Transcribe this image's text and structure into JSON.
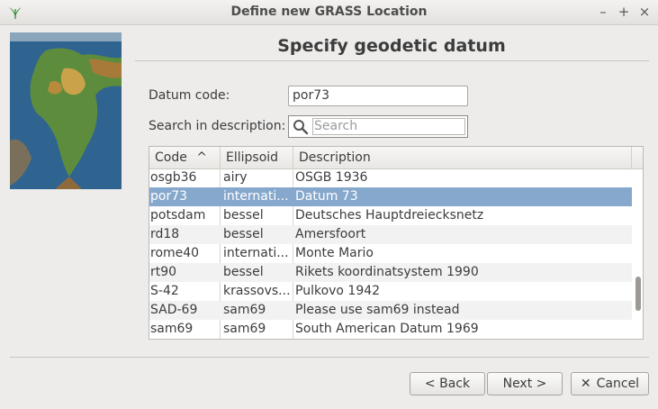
{
  "window": {
    "title": "Define new GRASS Location",
    "minimize": "–",
    "maximize": "+",
    "close": "×"
  },
  "page_title": "Specify geodetic datum",
  "datum": {
    "label": "Datum code:",
    "value": "por73"
  },
  "search": {
    "label": "Search in description:",
    "placeholder": "Search"
  },
  "table": {
    "headers": [
      "Code",
      "Ellipsoid",
      "Description"
    ],
    "sort_indicator": "^",
    "rows": [
      {
        "code": "osgb36",
        "ellipsoid": "airy",
        "description": "OSGB 1936"
      },
      {
        "code": "por73",
        "ellipsoid": "internati...",
        "description": "Datum 73"
      },
      {
        "code": "potsdam",
        "ellipsoid": "bessel",
        "description": "Deutsches Hauptdreiecksnetz"
      },
      {
        "code": "rd18",
        "ellipsoid": "bessel",
        "description": "Amersfoort"
      },
      {
        "code": "rome40",
        "ellipsoid": "internati...",
        "description": "Monte Mario"
      },
      {
        "code": "rt90",
        "ellipsoid": "bessel",
        "description": "Rikets koordinatsystem 1990"
      },
      {
        "code": "S-42",
        "ellipsoid": "krassovs...",
        "description": "Pulkovo 1942"
      },
      {
        "code": "SAD-69",
        "ellipsoid": "sam69",
        "description": "Please use sam69 instead"
      },
      {
        "code": "sam69",
        "ellipsoid": "sam69",
        "description": "South American Datum 1969"
      }
    ]
  },
  "buttons": {
    "back": "< Back",
    "next": "Next >",
    "cancel": "Cancel"
  },
  "colors": {
    "selection": "#86a8cc",
    "background": "#edeceb"
  }
}
